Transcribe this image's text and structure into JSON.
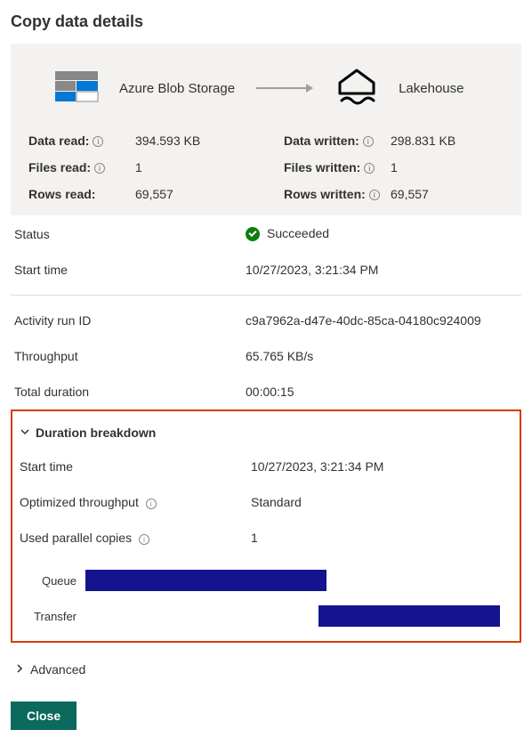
{
  "title": "Copy data details",
  "source": {
    "label": "Azure Blob Storage"
  },
  "destination": {
    "label": "Lakehouse"
  },
  "metrics": {
    "left": [
      {
        "label": "Data read:",
        "info": true,
        "value": "394.593 KB"
      },
      {
        "label": "Files read:",
        "info": true,
        "value": "1"
      },
      {
        "label": "Rows read:",
        "info": false,
        "value": "69,557"
      }
    ],
    "right": [
      {
        "label": "Data written:",
        "info": true,
        "value": "298.831 KB"
      },
      {
        "label": "Files written:",
        "info": true,
        "value": "1"
      },
      {
        "label": "Rows written:",
        "info": true,
        "value": "69,557"
      }
    ]
  },
  "status": {
    "label": "Status",
    "value": "Succeeded"
  },
  "starttime": {
    "label": "Start time",
    "value": "10/27/2023, 3:21:34 PM"
  },
  "runid": {
    "label": "Activity run ID",
    "value": "c9a7962a-d47e-40dc-85ca-04180c924009"
  },
  "throughput": {
    "label": "Throughput",
    "value": "65.765 KB/s"
  },
  "totaldur": {
    "label": "Total duration",
    "value": "00:00:15"
  },
  "breakdown": {
    "header": "Duration breakdown",
    "starttime": {
      "label": "Start time",
      "value": "10/27/2023, 3:21:34 PM"
    },
    "optthrough": {
      "label": "Optimized throughput",
      "value": "Standard"
    },
    "parallel": {
      "label": "Used parallel copies",
      "value": "1"
    },
    "bars": [
      {
        "label": "Queue",
        "left_pct": 0,
        "width_pct": 57
      },
      {
        "label": "Transfer",
        "left_pct": 55,
        "width_pct": 43
      }
    ]
  },
  "advanced": {
    "label": "Advanced"
  },
  "close": {
    "label": "Close"
  }
}
